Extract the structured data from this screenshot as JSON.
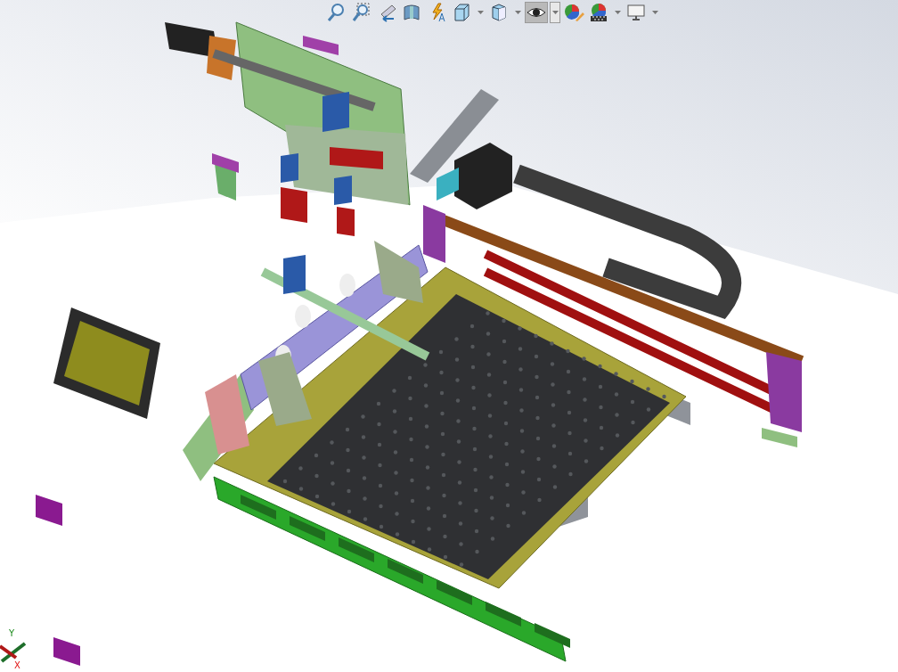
{
  "toolbar": {
    "buttons": [
      {
        "kind": "zoom-fit",
        "selected": false
      },
      {
        "kind": "zoom-area",
        "selected": false
      },
      {
        "kind": "previous-view",
        "selected": false
      },
      {
        "kind": "section-view",
        "selected": false
      },
      {
        "kind": "annotation",
        "selected": false
      },
      {
        "kind": "view-orientation",
        "selected": false
      },
      {
        "kind": "dropdown",
        "selected": false
      },
      {
        "kind": "display-style",
        "selected": false
      },
      {
        "kind": "dropdown",
        "selected": false
      },
      {
        "kind": "hide-show",
        "selected": true
      },
      {
        "kind": "dropdown",
        "selected": true
      },
      {
        "kind": "appearance",
        "selected": false
      },
      {
        "kind": "scene",
        "selected": false
      },
      {
        "kind": "dropdown",
        "selected": false
      },
      {
        "kind": "view-settings",
        "selected": false
      },
      {
        "kind": "dropdown",
        "selected": false
      }
    ]
  },
  "triad": {
    "y_label": "Y",
    "x_label": "X"
  }
}
